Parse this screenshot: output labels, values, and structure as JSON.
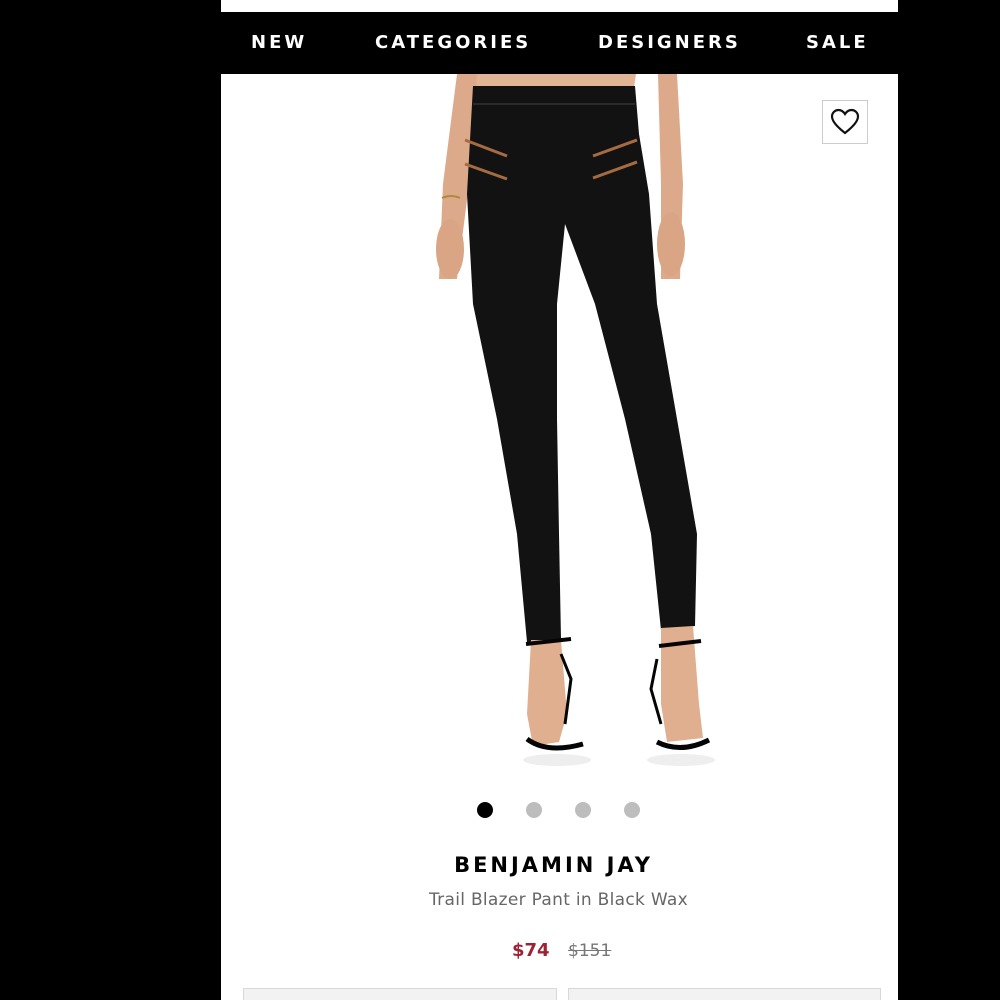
{
  "nav": {
    "items": [
      "NEW",
      "CATEGORIES",
      "DESIGNERS",
      "SALE"
    ]
  },
  "product": {
    "image_alt": "Black leggings with zip pockets worn with black strappy heels",
    "favorite_icon": "heart-outline-icon",
    "carousel": {
      "count": 4,
      "active_index": 0
    },
    "brand": "BENJAMIN JAY",
    "name": "Trail Blazer Pant in Black Wax",
    "price_sale": "$74",
    "price_original": "$151",
    "colors": {
      "sale": "#9b2335",
      "nav_bg": "#000000",
      "dot_active": "#000000",
      "dot_inactive": "#bdbdbd"
    }
  }
}
